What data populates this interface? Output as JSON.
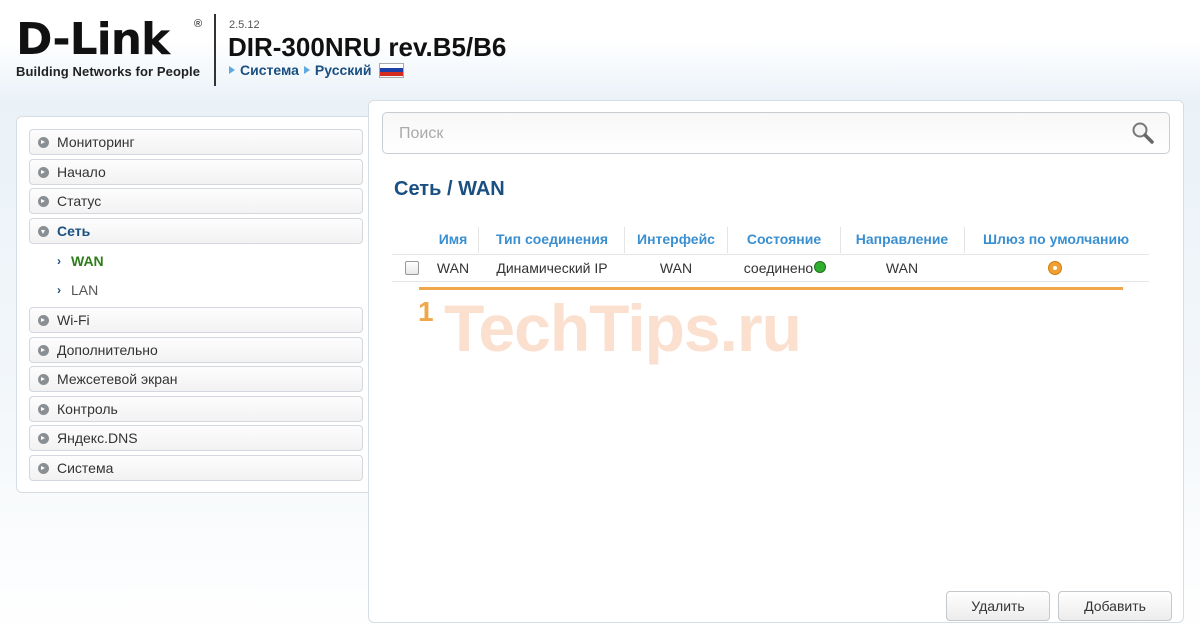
{
  "header": {
    "logo_text": "D-Link",
    "logo_registered": "®",
    "tagline": "Building Networks for People",
    "firmware": "2.5.12",
    "model": "DIR-300NRU rev.B5/B6",
    "breadcrumb": [
      "Система",
      "Русский"
    ],
    "flag_colors": [
      "#ffffff",
      "#1c3fa8",
      "#d52b1e"
    ]
  },
  "menu": {
    "items": [
      {
        "label": "Мониторинг"
      },
      {
        "label": "Начало"
      },
      {
        "label": "Статус"
      },
      {
        "label": "Сеть",
        "expanded": true,
        "active": true
      },
      {
        "label": "Wi-Fi"
      },
      {
        "label": "Дополнительно"
      },
      {
        "label": "Межсетевой экран"
      },
      {
        "label": "Контроль"
      },
      {
        "label": "Яндекс.DNS"
      },
      {
        "label": "Система"
      }
    ],
    "subitems": [
      {
        "label": "WAN",
        "selected": true
      },
      {
        "label": "LAN"
      }
    ]
  },
  "search": {
    "placeholder": "Поиск",
    "value": ""
  },
  "page": {
    "title": "Сеть /  WAN"
  },
  "table": {
    "headers": [
      "Имя",
      "Тип соединения",
      "Интерфейс",
      "Состояние",
      "Направление",
      "Шлюз по умолчанию"
    ],
    "rows": [
      {
        "name": "WAN",
        "type": "Динамический IP",
        "interface": "WAN",
        "state": "соединено",
        "direction": "WAN",
        "default_gateway": true,
        "checked": false
      }
    ]
  },
  "annotation": {
    "number": "1",
    "watermark": "TechTips.ru"
  },
  "buttons": {
    "delete": "Удалить",
    "add": "Добавить"
  },
  "colors": {
    "accent_blue": "#1a4f82",
    "header_blue": "#3a8fd0",
    "active_green": "#2f7d1a",
    "annotation_orange": "#f0a64a",
    "status_green": "#2fae2f"
  }
}
